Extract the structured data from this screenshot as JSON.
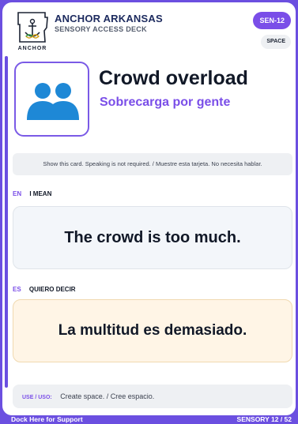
{
  "header": {
    "logo_text": "ANCHOR",
    "brand_name": "ANCHOR ARKANSAS",
    "brand_sub": "SENSORY ACCESS DECK",
    "badge": "SEN-12",
    "tag": "SPACE"
  },
  "card": {
    "icon": "people-icon",
    "title": "Crowd overload",
    "subtitle": "Sobrecarga por gente",
    "note": "Show this card. Speaking is not required. / Muestre esta tarjeta. No necesita hablar."
  },
  "english": {
    "lang": "EN",
    "label": "I MEAN",
    "phrase": "The crowd is too much."
  },
  "spanish": {
    "lang": "ES",
    "label": "QUIERO DECIR",
    "phrase": "La multitud es demasiado."
  },
  "use": {
    "label": "USE / USO:",
    "text": "Create space. / Cree espacio."
  },
  "footer": {
    "left": "Dock Here for Support",
    "right": "SENSORY 12 / 52"
  },
  "colors": {
    "accent": "#7a4ee8",
    "frame": "#6b4fe0",
    "icon_blue": "#1e88d6",
    "spanish_bg": "#fff5e6"
  }
}
